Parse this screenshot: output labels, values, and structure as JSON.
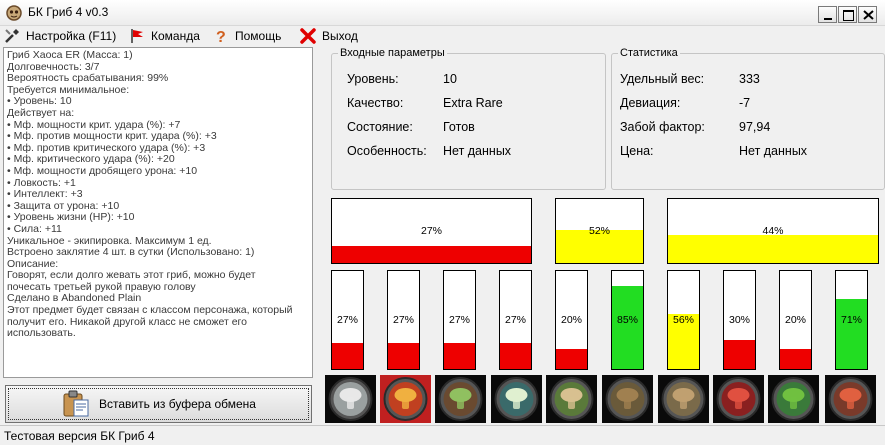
{
  "window": {
    "title": "БК Гриб 4 v0.3"
  },
  "menu": [
    {
      "label": "Настройка (F11)",
      "icon": "wrench-icon"
    },
    {
      "label": "Команда",
      "icon": "red-flag-icon"
    },
    {
      "label": "Помощь",
      "icon": "question-icon"
    },
    {
      "label": "Выход",
      "icon": "red-x-icon"
    }
  ],
  "description_lines": [
    "Гриб Хаоса ER  (Масса: 1)",
    "Долговечность: 3/7",
    "Вероятность срабатывания: 99%",
    "Требуется минимальное:",
    "• Уровень: 10",
    "Действует на:",
    "• Мф. мощности крит. удара (%): +7",
    "• Мф. против мощности крит. удара (%): +3",
    "• Мф. против критического удара (%): +3",
    "• Мф. критического удара (%): +20",
    "• Мф. мощности дробящего урона: +10",
    "• Ловкость: +1",
    "• Интеллект: +3",
    "• Защита от урона: +10",
    "• Уровень жизни (HP): +10",
    "• Сила: +11",
    "Уникальное - экипировка. Максимум 1 ед.",
    "Встроено заклятие 4 шт. в сутки (Использовано: 1)",
    "Описание:",
    "Говорят, если долго жевать этот гриб, можно будет",
    "почесать третьей рукой правую голову",
    "Сделано в Abandoned Plain",
    "Этот предмет будет связан с классом персонажа, который",
    "получит его. Никакой другой класс не сможет его",
    "использовать."
  ],
  "paste_button": {
    "label": "Вставить из буфера обмена"
  },
  "status_bar": "Тестовая версия БК Гриб 4",
  "input_params": {
    "title": "Входные параметры",
    "rows": [
      {
        "label": "Уровень:",
        "value": "10"
      },
      {
        "label": "Качество:",
        "value": "Extra Rare"
      },
      {
        "label": "Состояние:",
        "value": "Готов"
      },
      {
        "label": "Особенность:",
        "value": "Нет данных"
      }
    ]
  },
  "statistics": {
    "title": "Статистика",
    "rows": [
      {
        "label": "Удельный вес:",
        "value": "333"
      },
      {
        "label": "Девиация:",
        "value": "-7"
      },
      {
        "label": "Забой фактор:",
        "value": "97,94"
      },
      {
        "label": "Цена:",
        "value": "Нет данных"
      }
    ]
  },
  "colors": {
    "red": "#ee0000",
    "yellow": "#ffff00",
    "green": "#22dd22"
  },
  "big_bars": [
    {
      "label": "27%",
      "value": 27,
      "color": "red"
    },
    {
      "label": "52%",
      "value": 52,
      "color": "yellow"
    },
    {
      "label": "44%",
      "value": 44,
      "color": "yellow"
    }
  ],
  "small_bars": [
    {
      "label": "27%",
      "value": 27,
      "color": "red"
    },
    {
      "label": "27%",
      "value": 27,
      "color": "red"
    },
    {
      "label": "27%",
      "value": 27,
      "color": "red"
    },
    {
      "label": "27%",
      "value": 27,
      "color": "red"
    },
    {
      "label": "20%",
      "value": 20,
      "color": "red"
    },
    {
      "label": "85%",
      "value": 85,
      "color": "green"
    },
    {
      "label": "56%",
      "value": 56,
      "color": "yellow"
    },
    {
      "label": "30%",
      "value": 30,
      "color": "red"
    },
    {
      "label": "20%",
      "value": 20,
      "color": "red"
    },
    {
      "label": "71%",
      "value": 71,
      "color": "green"
    }
  ],
  "item_icons": [
    {
      "name": "mushroom-icon-1"
    },
    {
      "name": "mushroom-icon-2",
      "selected": true
    },
    {
      "name": "mushroom-icon-3"
    },
    {
      "name": "mushroom-icon-4"
    },
    {
      "name": "mushroom-icon-5"
    },
    {
      "name": "mushroom-icon-6"
    },
    {
      "name": "mushroom-icon-7"
    },
    {
      "name": "mushroom-icon-8"
    },
    {
      "name": "mushroom-icon-9"
    },
    {
      "name": "mushroom-icon-10"
    }
  ]
}
